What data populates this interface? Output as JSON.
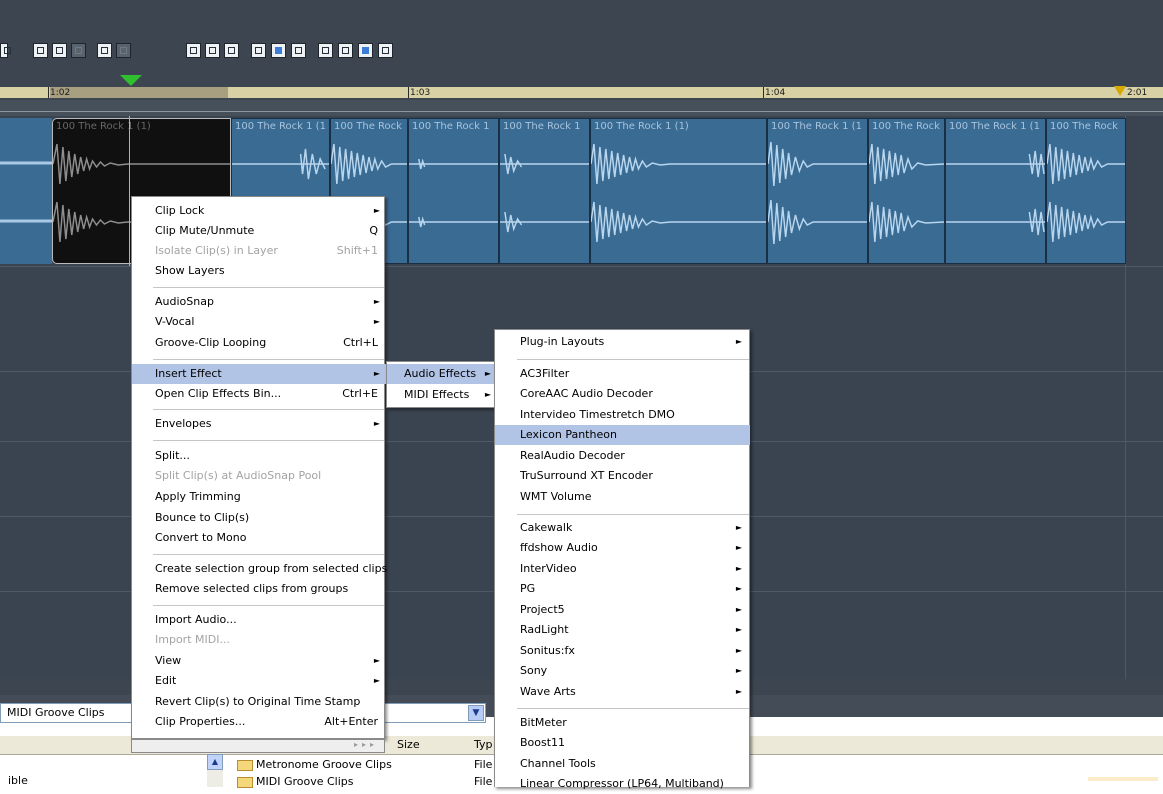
{
  "ruler": {
    "markers": [
      {
        "label": "1:02"
      },
      {
        "label": "1:03"
      },
      {
        "label": "1:04"
      },
      {
        "label": "2:01"
      }
    ]
  },
  "clips": [
    {
      "label": "100 The Rock 1 (1)"
    },
    {
      "label": "100 The Rock 1 (1"
    },
    {
      "label": "100 The Rock"
    },
    {
      "label": "100 The Rock 1"
    },
    {
      "label": "100 The Rock 1"
    },
    {
      "label": "100 The Rock 1 (1)"
    },
    {
      "label": "100 The Rock 1 (1"
    },
    {
      "label": "100 The Rock"
    },
    {
      "label": "100 The Rock 1 (1"
    },
    {
      "label": "100 The Rock"
    }
  ],
  "browser": {
    "selected_folder": "MIDI Groove Clips",
    "columns": {
      "size": "Size",
      "type": "Typ"
    },
    "side_label": "ible",
    "files": [
      {
        "name": "Metronome Groove Clips",
        "type": "File"
      },
      {
        "name": "MIDI Groove Clips",
        "type": "File"
      }
    ]
  },
  "context_menu": {
    "items": [
      {
        "label": "Clip Lock",
        "shortcut": "",
        "arrow": "►"
      },
      {
        "label": "Clip Mute/Unmute",
        "shortcut": "Q",
        "arrow": ""
      },
      {
        "label": "Isolate Clip(s) in Layer",
        "shortcut": "Shift+1",
        "arrow": ""
      },
      {
        "label": "Show Layers",
        "shortcut": "",
        "arrow": ""
      },
      {
        "label": "AudioSnap",
        "shortcut": "",
        "arrow": "►"
      },
      {
        "label": "V-Vocal",
        "shortcut": "",
        "arrow": "►"
      },
      {
        "label": "Groove-Clip Looping",
        "shortcut": "Ctrl+L",
        "arrow": ""
      },
      {
        "label": "Insert Effect",
        "shortcut": "",
        "arrow": "►"
      },
      {
        "label": "Open Clip Effects Bin...",
        "shortcut": "Ctrl+E",
        "arrow": ""
      },
      {
        "label": "Envelopes",
        "shortcut": "",
        "arrow": "►"
      },
      {
        "label": "Split...",
        "shortcut": "",
        "arrow": ""
      },
      {
        "label": "Split Clip(s) at AudioSnap Pool",
        "shortcut": "",
        "arrow": ""
      },
      {
        "label": "Apply Trimming",
        "shortcut": "",
        "arrow": ""
      },
      {
        "label": "Bounce to Clip(s)",
        "shortcut": "",
        "arrow": ""
      },
      {
        "label": "Convert to Mono",
        "shortcut": "",
        "arrow": ""
      },
      {
        "label": "Create selection group from selected clips",
        "shortcut": "",
        "arrow": ""
      },
      {
        "label": "Remove selected clips from groups",
        "shortcut": "",
        "arrow": ""
      },
      {
        "label": "Import Audio...",
        "shortcut": "",
        "arrow": ""
      },
      {
        "label": "Import MIDI...",
        "shortcut": "",
        "arrow": ""
      },
      {
        "label": "View",
        "shortcut": "",
        "arrow": "►"
      },
      {
        "label": "Edit",
        "shortcut": "",
        "arrow": "►"
      },
      {
        "label": "Revert Clip(s) to Original Time Stamp",
        "shortcut": "",
        "arrow": ""
      },
      {
        "label": "Clip Properties...",
        "shortcut": "Alt+Enter",
        "arrow": ""
      }
    ],
    "scroll_arrows": "▸▸▸"
  },
  "insert_effect_submenu": {
    "items": [
      {
        "label": "Audio Effects",
        "arrow": "►"
      },
      {
        "label": "MIDI Effects",
        "arrow": "►"
      }
    ]
  },
  "audio_effects_submenu": {
    "items": [
      {
        "label": "Plug-in Layouts",
        "arrow": "►"
      },
      {
        "label": "AC3Filter",
        "arrow": ""
      },
      {
        "label": "CoreAAC Audio Decoder",
        "arrow": ""
      },
      {
        "label": "Intervideo Timestretch DMO",
        "arrow": ""
      },
      {
        "label": "Lexicon Pantheon",
        "arrow": ""
      },
      {
        "label": "RealAudio Decoder",
        "arrow": ""
      },
      {
        "label": "TruSurround XT Encoder",
        "arrow": ""
      },
      {
        "label": "WMT Volume",
        "arrow": ""
      },
      {
        "label": "Cakewalk",
        "arrow": "►"
      },
      {
        "label": "ffdshow Audio",
        "arrow": "►"
      },
      {
        "label": "InterVideo",
        "arrow": "►"
      },
      {
        "label": "PG",
        "arrow": "►"
      },
      {
        "label": "Project5",
        "arrow": "►"
      },
      {
        "label": "RadLight",
        "arrow": "►"
      },
      {
        "label": "Sonitus:fx",
        "arrow": "►"
      },
      {
        "label": "Sony",
        "arrow": "►"
      },
      {
        "label": "Wave Arts",
        "arrow": "►"
      },
      {
        "label": "BitMeter",
        "arrow": ""
      },
      {
        "label": "Boost11",
        "arrow": ""
      },
      {
        "label": "Channel Tools",
        "arrow": ""
      },
      {
        "label": "Linear Compressor (LP64, Multiband)",
        "arrow": ""
      }
    ]
  },
  "icons": {
    "submenu_arrow": "►",
    "dropdown": "▼",
    "scroll_up": "▲"
  },
  "colors": {
    "menu_highlight": "#b2c4e6",
    "clip_blue": "#3a6b93",
    "track_bg": "#3a4450",
    "playhead_marker": "#2fbf2f"
  }
}
